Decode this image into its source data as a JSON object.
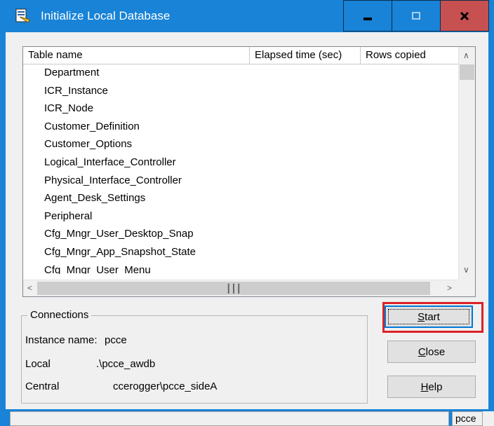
{
  "window": {
    "title": "Initialize Local Database",
    "title_bar_color": "#1883d7",
    "close_color": "#c75050"
  },
  "table": {
    "columns": [
      "Table name",
      "Elapsed time (sec)",
      "Rows copied"
    ],
    "rows": [
      "Department",
      "ICR_Instance",
      "ICR_Node",
      "Customer_Definition",
      "Customer_Options",
      "Logical_Interface_Controller",
      "Physical_Interface_Controller",
      "Agent_Desk_Settings",
      "Peripheral",
      "Cfg_Mngr_User_Desktop_Snap",
      "Cfg_Mngr_App_Snapshot_State",
      "Cfg_Mngr_User_Menu"
    ]
  },
  "connections": {
    "group_label": "Connections",
    "instance_label": "Instance name:",
    "instance_value": "pcce",
    "local_label": "Local",
    "local_value": ".\\pcce_awdb",
    "central_label": "Central",
    "central_value": "ccerogger\\pcce_sideA"
  },
  "buttons": {
    "start_key": "S",
    "start_rest": "tart",
    "close_key": "C",
    "close_rest": "lose",
    "help_key": "H",
    "help_rest": "elp"
  },
  "statusbar": {
    "pane_text": "pcce"
  },
  "colors": {
    "highlight": "#dc2226"
  }
}
